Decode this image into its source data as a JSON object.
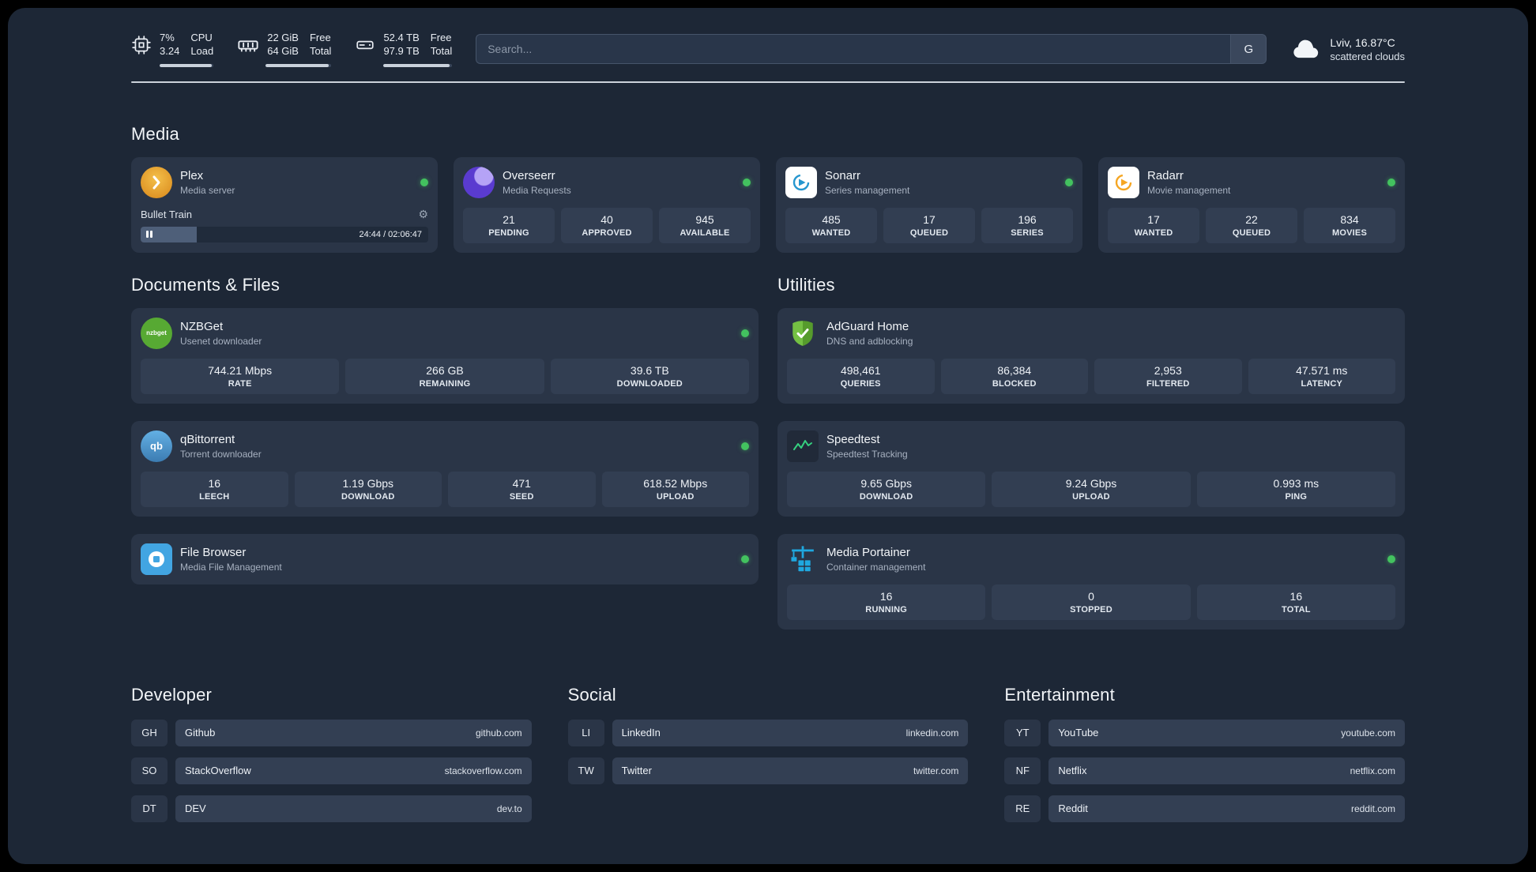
{
  "header": {
    "cpu": {
      "percent": "7%",
      "load": "3.24",
      "label_top": "CPU",
      "label_bottom": "Load",
      "bar": 96
    },
    "ram": {
      "free": "22 GiB",
      "total": "64 GiB",
      "label_top": "Free",
      "label_bottom": "Total",
      "bar": 96
    },
    "disk": {
      "free": "52.4 TB",
      "total": "97.9 TB",
      "label_top": "Free",
      "label_bottom": "Total",
      "bar": 96
    },
    "search": {
      "placeholder": "Search...",
      "engine_button": "G"
    },
    "weather": {
      "location": "Lviv, 16.87°C",
      "condition": "scattered clouds"
    }
  },
  "sections": {
    "media": "Media",
    "documents": "Documents & Files",
    "utilities": "Utilities",
    "developer": "Developer",
    "social": "Social",
    "entertainment": "Entertainment"
  },
  "icons": {
    "gear": "⚙",
    "nzbget_text": "nzbget",
    "qb_text": "qb"
  },
  "media_cards": {
    "plex": {
      "title": "Plex",
      "subtitle": "Media server",
      "player": {
        "track": "Bullet Train",
        "time": "24:44 / 02:06:47",
        "progress": 19.5
      }
    },
    "overseerr": {
      "title": "Overseerr",
      "subtitle": "Media Requests",
      "stats": [
        {
          "value": "21",
          "label": "PENDING"
        },
        {
          "value": "40",
          "label": "APPROVED"
        },
        {
          "value": "945",
          "label": "AVAILABLE"
        }
      ]
    },
    "sonarr": {
      "title": "Sonarr",
      "subtitle": "Series management",
      "stats": [
        {
          "value": "485",
          "label": "WANTED"
        },
        {
          "value": "17",
          "label": "QUEUED"
        },
        {
          "value": "196",
          "label": "SERIES"
        }
      ]
    },
    "radarr": {
      "title": "Radarr",
      "subtitle": "Movie management",
      "stats": [
        {
          "value": "17",
          "label": "WANTED"
        },
        {
          "value": "22",
          "label": "QUEUED"
        },
        {
          "value": "834",
          "label": "MOVIES"
        }
      ]
    }
  },
  "document_cards": {
    "nzbget": {
      "title": "NZBGet",
      "subtitle": "Usenet downloader",
      "stats": [
        {
          "value": "744.21 Mbps",
          "label": "RATE"
        },
        {
          "value": "266 GB",
          "label": "REMAINING"
        },
        {
          "value": "39.6 TB",
          "label": "DOWNLOADED"
        }
      ]
    },
    "qbittorrent": {
      "title": "qBittorrent",
      "subtitle": "Torrent downloader",
      "stats": [
        {
          "value": "16",
          "label": "LEECH"
        },
        {
          "value": "1.19 Gbps",
          "label": "DOWNLOAD"
        },
        {
          "value": "471",
          "label": "SEED"
        },
        {
          "value": "618.52 Mbps",
          "label": "UPLOAD"
        }
      ]
    },
    "filebrowser": {
      "title": "File Browser",
      "subtitle": "Media File Management"
    }
  },
  "utility_cards": {
    "adguard": {
      "title": "AdGuard Home",
      "subtitle": "DNS and adblocking",
      "stats": [
        {
          "value": "498,461",
          "label": "QUERIES"
        },
        {
          "value": "86,384",
          "label": "BLOCKED"
        },
        {
          "value": "2,953",
          "label": "FILTERED"
        },
        {
          "value": "47.571 ms",
          "label": "LATENCY"
        }
      ]
    },
    "speedtest": {
      "title": "Speedtest",
      "subtitle": "Speedtest Tracking",
      "stats": [
        {
          "value": "9.65 Gbps",
          "label": "DOWNLOAD"
        },
        {
          "value": "9.24 Gbps",
          "label": "UPLOAD"
        },
        {
          "value": "0.993 ms",
          "label": "PING"
        }
      ]
    },
    "portainer": {
      "title": "Media Portainer",
      "subtitle": "Container management",
      "stats": [
        {
          "value": "16",
          "label": "RUNNING"
        },
        {
          "value": "0",
          "label": "STOPPED"
        },
        {
          "value": "16",
          "label": "TOTAL"
        }
      ]
    }
  },
  "bookmarks": {
    "developer": [
      {
        "abbr": "GH",
        "name": "Github",
        "url": "github.com"
      },
      {
        "abbr": "SO",
        "name": "StackOverflow",
        "url": "stackoverflow.com"
      },
      {
        "abbr": "DT",
        "name": "DEV",
        "url": "dev.to"
      }
    ],
    "social": [
      {
        "abbr": "LI",
        "name": "LinkedIn",
        "url": "linkedin.com"
      },
      {
        "abbr": "TW",
        "name": "Twitter",
        "url": "twitter.com"
      }
    ],
    "entertainment": [
      {
        "abbr": "YT",
        "name": "YouTube",
        "url": "youtube.com"
      },
      {
        "abbr": "NF",
        "name": "Netflix",
        "url": "netflix.com"
      },
      {
        "abbr": "RE",
        "name": "Reddit",
        "url": "reddit.com"
      }
    ]
  },
  "colors": {
    "status_green": "#43c25f",
    "accent_blue": "#1fa8e0"
  }
}
